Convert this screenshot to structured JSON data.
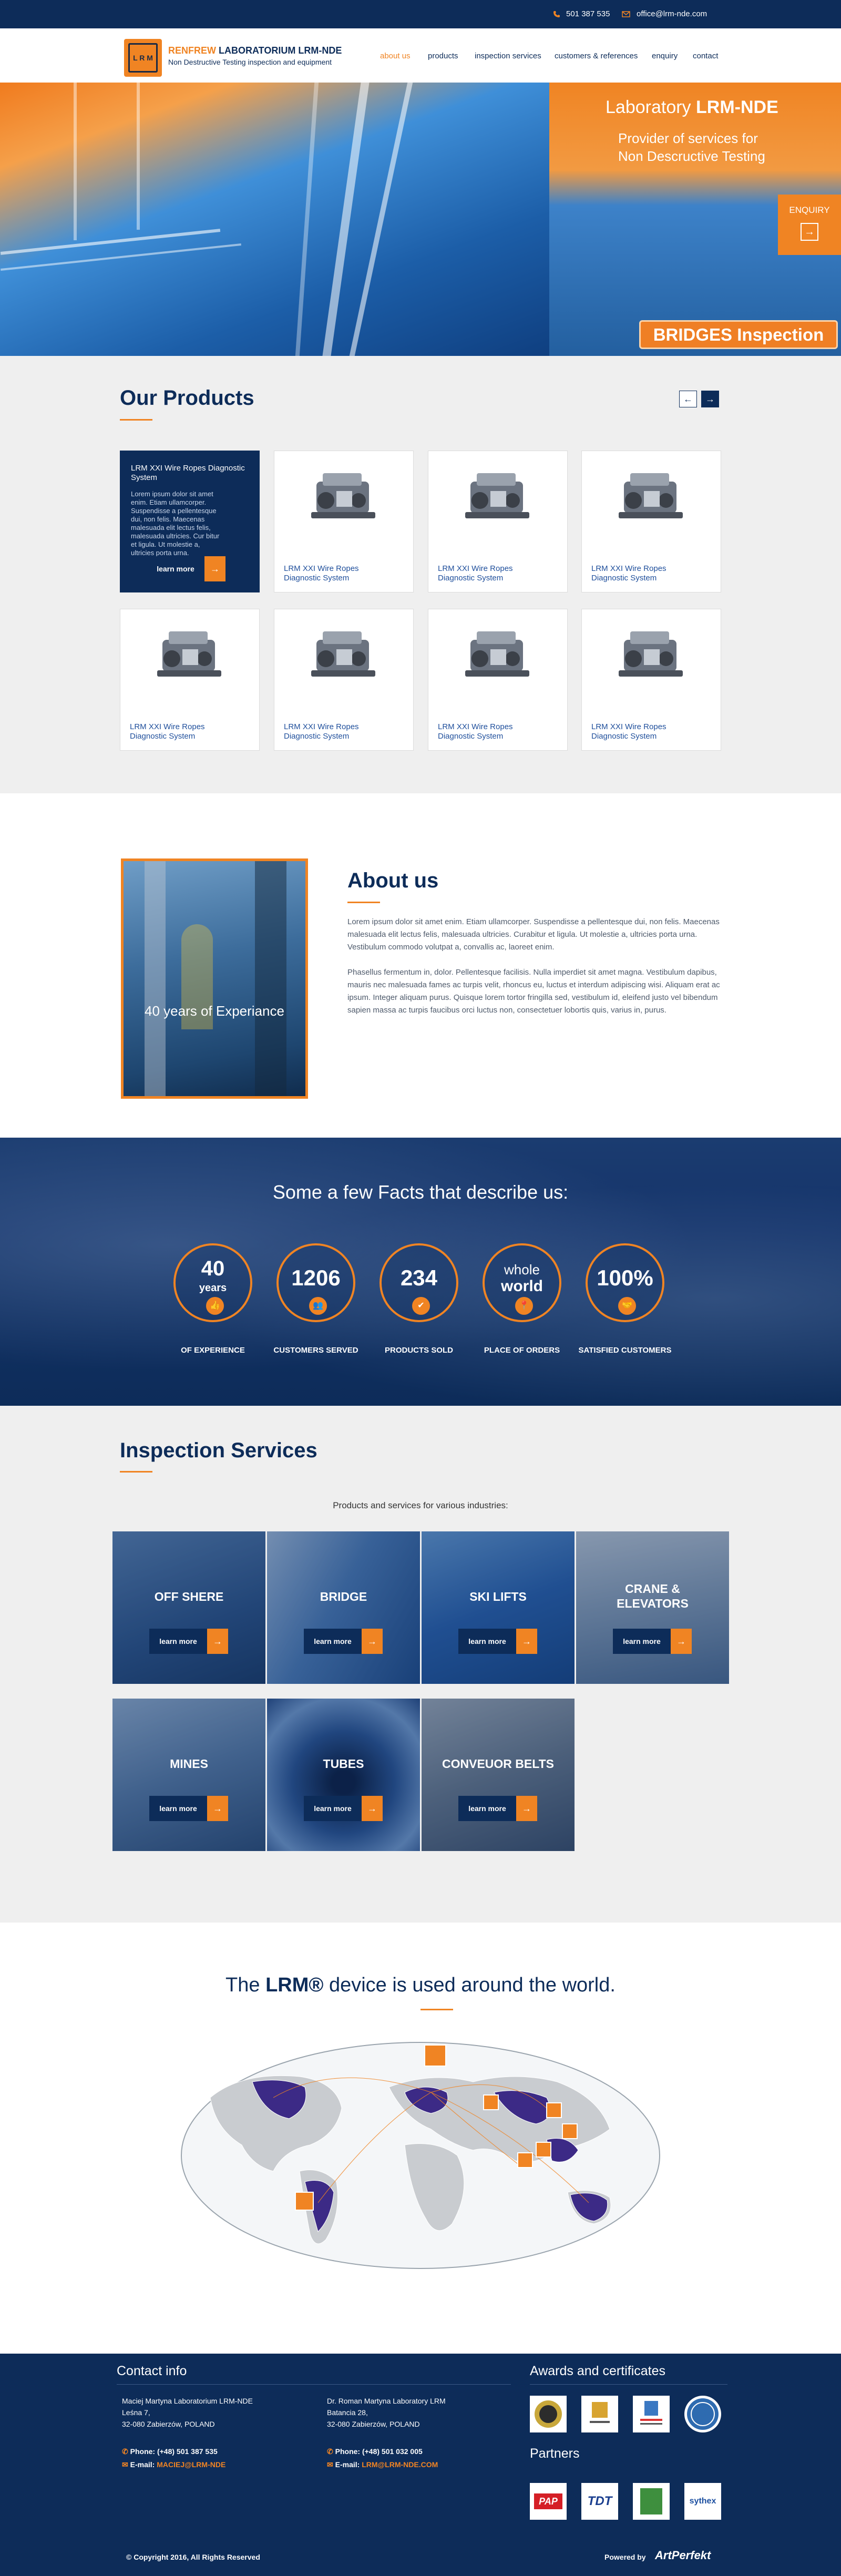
{
  "topbar": {
    "phone": "501 387 535",
    "email": "office@lrm-nde.com"
  },
  "header": {
    "logo_text": "L R M",
    "brand_orange": "RENFREW",
    "brand_navy": "LABORATORIUM LRM-NDE",
    "tagline": "Non Destructive Testing inspection and equipment",
    "nav": [
      "about us",
      "products",
      "inspection services",
      "customers & references",
      "enquiry",
      "contact"
    ]
  },
  "hero": {
    "lab_prefix": "Laboratory",
    "lab_name": "LRM-NDE",
    "line1": "Provider of services for",
    "line2": "Non Descructive Testing",
    "enquiry": "ENQUIRY",
    "badge": "BRIDGES Inspection"
  },
  "products": {
    "title": "Our Products",
    "featured_title": "LRM XXI Wire Ropes Diagnostic System",
    "featured_desc": "Lorem ipsum dolor sit amet enim. Etiam ullamcorper. Suspendisse a pellentesque dui, non felis. Maecenas malesuada elit lectus felis, malesuada ultricies. Cur bitur et ligula. Ut molestie a, ultricies porta urna.",
    "learn_more": "learn more",
    "card_title_1": "LRM XXI Wire Ropes",
    "card_title_2": "Diagnostic System"
  },
  "about": {
    "title": "About us",
    "image_caption": "40 years of Experiance",
    "p1": "Lorem ipsum dolor sit amet enim. Etiam ullamcorper. Suspendisse a pellentesque dui, non felis. Maecenas malesuada elit lectus felis, malesuada ultricies. Curabitur et ligula. Ut molestie a, ultricies porta urna. Vestibulum commodo volutpat a, convallis ac, laoreet enim.",
    "p2": "Phasellus fermentum in, dolor. Pellentesque facilisis. Nulla imperdiet sit amet magna. Vestibulum dapibus, mauris nec malesuada fames ac turpis velit, rhoncus eu, luctus et interdum adipiscing wisi. Aliquam erat ac ipsum. Integer aliquam purus. Quisque lorem tortor fringilla sed, vestibulum id, eleifend justo vel bibendum sapien massa ac turpis faucibus orci luctus non, consectetuer lobortis quis, varius in, purus."
  },
  "facts": {
    "title": "Some a few Facts that describe us:",
    "items": [
      {
        "value": "40",
        "sub": "years",
        "label": "OF EXPERIENCE"
      },
      {
        "value": "1206",
        "label": "CUSTOMERS SERVED"
      },
      {
        "value": "234",
        "label": "PRODUCTS SOLD"
      },
      {
        "value": "whole",
        "sub": "world",
        "label": "PLACE OF ORDERS"
      },
      {
        "value": "100%",
        "label": "SATISFIED CUSTOMERS"
      }
    ]
  },
  "inspection": {
    "title": "Inspection Services",
    "subtitle": "Products and services for various industries:",
    "learn_more": "learn more",
    "tiles": [
      {
        "label": "OFF SHERE"
      },
      {
        "label": "BRIDGE"
      },
      {
        "label": "SKI LIFTS"
      },
      {
        "label1": "CRANE &",
        "label2": "ELEVATORS"
      },
      {
        "label": "MINES"
      },
      {
        "label": "TUBES"
      },
      {
        "label": "CONVEUOR BELTS"
      }
    ]
  },
  "map": {
    "title_pre": "The",
    "title_brand": "LRM®",
    "title_post": "device is used around the world."
  },
  "footer": {
    "contact_title": "Contact info",
    "col1": {
      "l1": "Maciej Martyna Laboratorium LRM-NDE",
      "l2": "Leśna 7,",
      "l3": "32-080 Zabierzów, POLAND",
      "phone_label": "Phone:",
      "phone": "(+48) 501 387 535",
      "email_label": "E-mail:",
      "email": "MACIEJ@LRM-NDE"
    },
    "col2": {
      "l1": "Dr. Roman Martyna  Laboratory LRM",
      "l2": "Batancia 28,",
      "l3": "32-080 Zabierzów, POLAND",
      "phone_label": "Phone:",
      "phone": "(+48) 501 032 005",
      "email_label": "E-mail:",
      "email": "LRM@LRM-NDE.COM"
    },
    "awards_title": "Awards and certificates",
    "partners_title": "Partners",
    "partners": [
      "PAP",
      "TDT",
      "",
      "sythex"
    ],
    "copyright": "© Copyright 2016, All Rights Reserved",
    "powered": "Powered by",
    "powered_brand": "ArtPerfekt"
  },
  "colors": {
    "navy": "#0d2c59",
    "orange": "#f08423"
  }
}
